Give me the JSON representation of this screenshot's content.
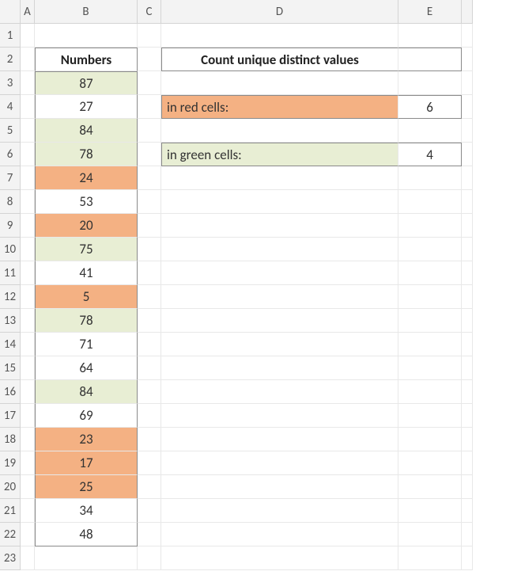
{
  "columns": [
    "A",
    "B",
    "C",
    "D",
    "E",
    ""
  ],
  "row_labels": [
    "1",
    "2",
    "3",
    "4",
    "5",
    "6",
    "7",
    "8",
    "9",
    "10",
    "11",
    "12",
    "13",
    "14",
    "15",
    "16",
    "17",
    "18",
    "19",
    "20",
    "21",
    "22",
    "23"
  ],
  "headers": {
    "numbers": "Numbers",
    "count_title": "Count unique distinct values"
  },
  "labels": {
    "red": "in red cells:",
    "green": "in green cells:"
  },
  "results": {
    "red": "6",
    "green": "4"
  },
  "numbers": [
    {
      "v": "87",
      "fill": "green"
    },
    {
      "v": "27",
      "fill": "none"
    },
    {
      "v": "84",
      "fill": "green"
    },
    {
      "v": "78",
      "fill": "green"
    },
    {
      "v": "24",
      "fill": "orange"
    },
    {
      "v": "53",
      "fill": "none"
    },
    {
      "v": "20",
      "fill": "orange"
    },
    {
      "v": "75",
      "fill": "green"
    },
    {
      "v": "41",
      "fill": "none"
    },
    {
      "v": "5",
      "fill": "orange"
    },
    {
      "v": "78",
      "fill": "green"
    },
    {
      "v": "71",
      "fill": "none"
    },
    {
      "v": "64",
      "fill": "none"
    },
    {
      "v": "84",
      "fill": "green"
    },
    {
      "v": "69",
      "fill": "none"
    },
    {
      "v": "23",
      "fill": "orange"
    },
    {
      "v": "17",
      "fill": "orange"
    },
    {
      "v": "25",
      "fill": "orange"
    },
    {
      "v": "34",
      "fill": "none"
    },
    {
      "v": "48",
      "fill": "none"
    }
  ],
  "colors": {
    "green": "#e8eed4",
    "orange": "#f4b183"
  }
}
